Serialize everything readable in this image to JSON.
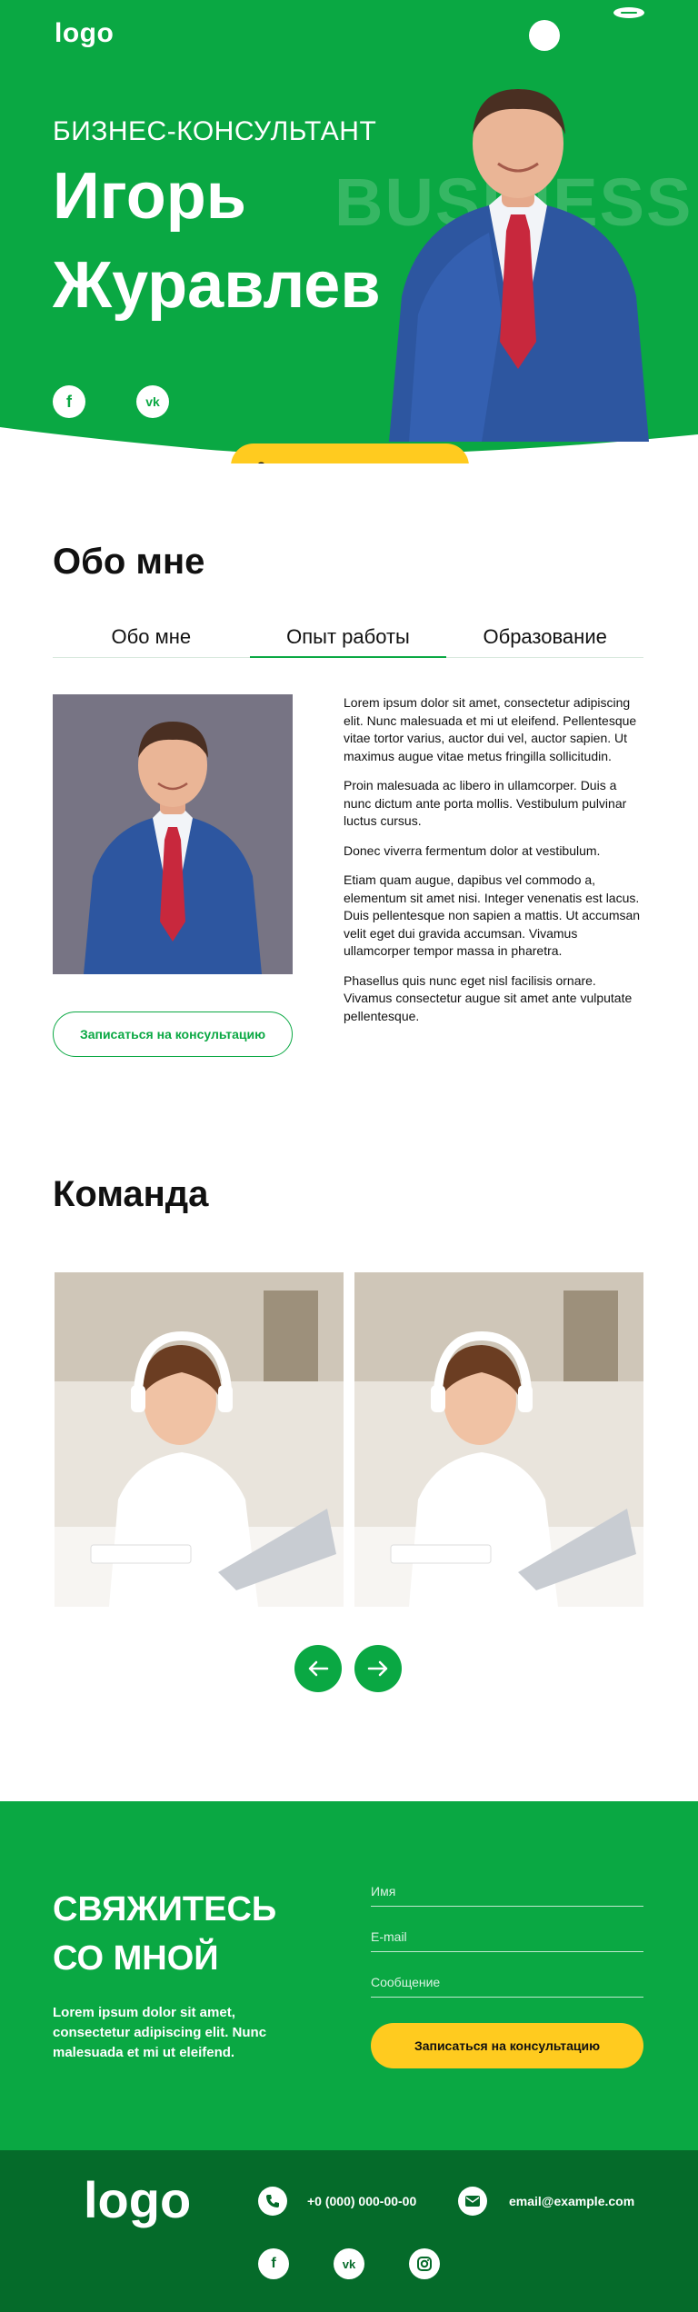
{
  "header": {
    "logo": "logo",
    "theme_toggle_icon": "circle-icon",
    "menu_icon": "menu-icon"
  },
  "hero": {
    "subtitle": "БИЗНЕС-КОНСУЛЬТАНТ",
    "name_line1": "Игорь",
    "name_line2": "Журавлев",
    "background_word": "BUSINESS",
    "social_icons": [
      "facebook-icon",
      "vk-icon"
    ],
    "cta": "Записаться на консультацию"
  },
  "about": {
    "title": "Обо мне",
    "tabs": [
      {
        "label": "Обо мне",
        "active": false
      },
      {
        "label": "Опыт работы",
        "active": true
      },
      {
        "label": "Образование",
        "active": false
      }
    ],
    "paragraphs": [
      "Lorem ipsum dolor sit amet, consectetur adipiscing elit. Nunc malesuada et mi ut eleifend. Pellentesque vitae tortor varius, auctor dui vel, auctor sapien. Ut maximus augue vitae metus fringilla sollicitudin.",
      "Proin malesuada ac libero in ullamcorper. Duis a nunc dictum ante porta mollis. Vestibulum pulvinar luctus cursus.",
      "Donec viverra fermentum dolor at vestibulum.",
      "Etiam quam augue, dapibus vel commodo a, elementum sit amet nisi. Integer venenatis est lacus. Duis pellentesque non sapien a mattis. Ut accumsan velit eget dui gravida accumsan. Vivamus ullamcorper tempor massa in pharetra.",
      "Phasellus quis nunc eget nisl facilisis ornare. Vivamus consectetur augue sit amet ante vulputate pellentesque."
    ],
    "cta": "Записаться на консультацию"
  },
  "team": {
    "title": "Команда",
    "prev_icon": "arrow-left-icon",
    "next_icon": "arrow-right-icon"
  },
  "contact": {
    "title_line1": "СВЯЖИТЕСЬ",
    "title_line2": "СО МНОЙ",
    "text": "Lorem ipsum dolor sit amet, consectetur adipiscing elit. Nunc malesuada et mi ut eleifend.",
    "name_placeholder": "Имя",
    "email_placeholder": "E-mail",
    "message_placeholder": "Сообщение",
    "cta": "Записаться на консультацию"
  },
  "footer": {
    "logo": "logo",
    "phone": "+0 (000) 000-00-00",
    "email": "email@example.com",
    "social_icons": [
      "facebook-icon",
      "vk-icon",
      "instagram-icon"
    ]
  },
  "colors": {
    "brand_green": "#0aa843",
    "footer_green": "#056b2a",
    "accent_yellow": "#ffcb1f"
  }
}
